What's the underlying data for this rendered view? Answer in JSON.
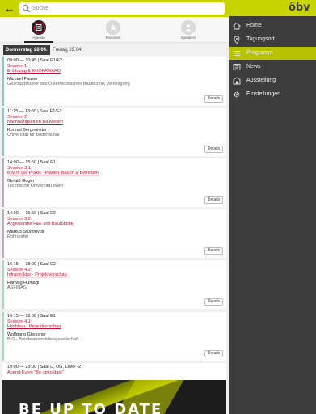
{
  "search": {
    "placeholder": "Suche"
  },
  "tabs": [
    {
      "label": "Agenda",
      "icon": "agenda-icon",
      "active": true
    },
    {
      "label": "Favoriten",
      "icon": "star-icon",
      "active": false
    },
    {
      "label": "Speakers",
      "icon": "person-icon",
      "active": false
    }
  ],
  "days": [
    {
      "label": "Donnerstag 28.04.",
      "active": true
    },
    {
      "label": "Freitag 29.04.",
      "active": false
    }
  ],
  "sessions": [
    {
      "time": "09:00 — 10:45 | Saal E1/E2",
      "session": "Session 1:",
      "title": "Eröffnung & KOOPAWARD",
      "speaker": "Michael Pauser",
      "org": "Geschäftsführer des Österreichischen Bautechnik Vereinigung",
      "details": "Details",
      "color": "#8fc1d8"
    },
    {
      "time": "11:15 — 13:00 | Saal E1/E2",
      "session": "Session 2:",
      "title": "Nachhaltigkeit im Bauwesen",
      "speaker": "Konrad Bergmeister",
      "org": "Universität für Bodenkultur",
      "details": "Details",
      "color": "#8fc1d8"
    },
    {
      "time": "14:00 — 15:50 | Saal E1",
      "session": "Session 3.1:",
      "title": "BIM in der Praxis - Planen, Bauen & Betreiben",
      "speaker": "Gerald Goger",
      "org": "Technische Universität Wien",
      "details": "Details",
      "color": "#c4a6d2"
    },
    {
      "time": "14:00 — 15:50 | Saal E2",
      "session": "Session 3.2:",
      "title": "Angewandte F&E und Baurobotik",
      "speaker": "Markus Stummvoll",
      "org": "Rohrdorfer",
      "details": "Details",
      "color": "#c4a6d2"
    },
    {
      "time": "16:15 — 18:00 | Saal E2",
      "session": "Session 4.2:",
      "title": "Infrastruktur - Projektvorschau",
      "speaker": "Hartwig Hufnagl",
      "org": "ASFINAG",
      "details": "Details",
      "color": "#a9d7b8"
    },
    {
      "time": "16:15 — 18:00 | Saal E1",
      "session": "Session 4.1:",
      "title": "Hochbau - Projektvorschau",
      "speaker": "Wolfgang Gleissner",
      "org": "BIG - Bundesimmobiliengesellschaft",
      "details": "Details",
      "color": "#a9d7b8"
    }
  ],
  "evening": {
    "time": "19:00 — 23:00 | Saal D, UG, Level -2",
    "title": "Abend-Event \"Be up to date\"",
    "image_text": "BE  UP TO DATE"
  },
  "nav": {
    "logo": "öbv",
    "items": [
      {
        "label": "Home",
        "icon": "home-icon",
        "active": false
      },
      {
        "label": "Tagungsort",
        "icon": "location-pin-icon",
        "active": false
      },
      {
        "label": "Programm",
        "icon": "list-icon",
        "active": true
      },
      {
        "label": "News",
        "icon": "news-icon",
        "active": false
      },
      {
        "label": "Ausstellung",
        "icon": "building-icon",
        "active": false
      },
      {
        "label": "Einstellungen",
        "icon": "gear-icon",
        "active": false
      }
    ]
  },
  "colors": {
    "brand": "#c8d400",
    "accent_red": "#c8102e",
    "nav_bg": "#3d3d3d"
  }
}
